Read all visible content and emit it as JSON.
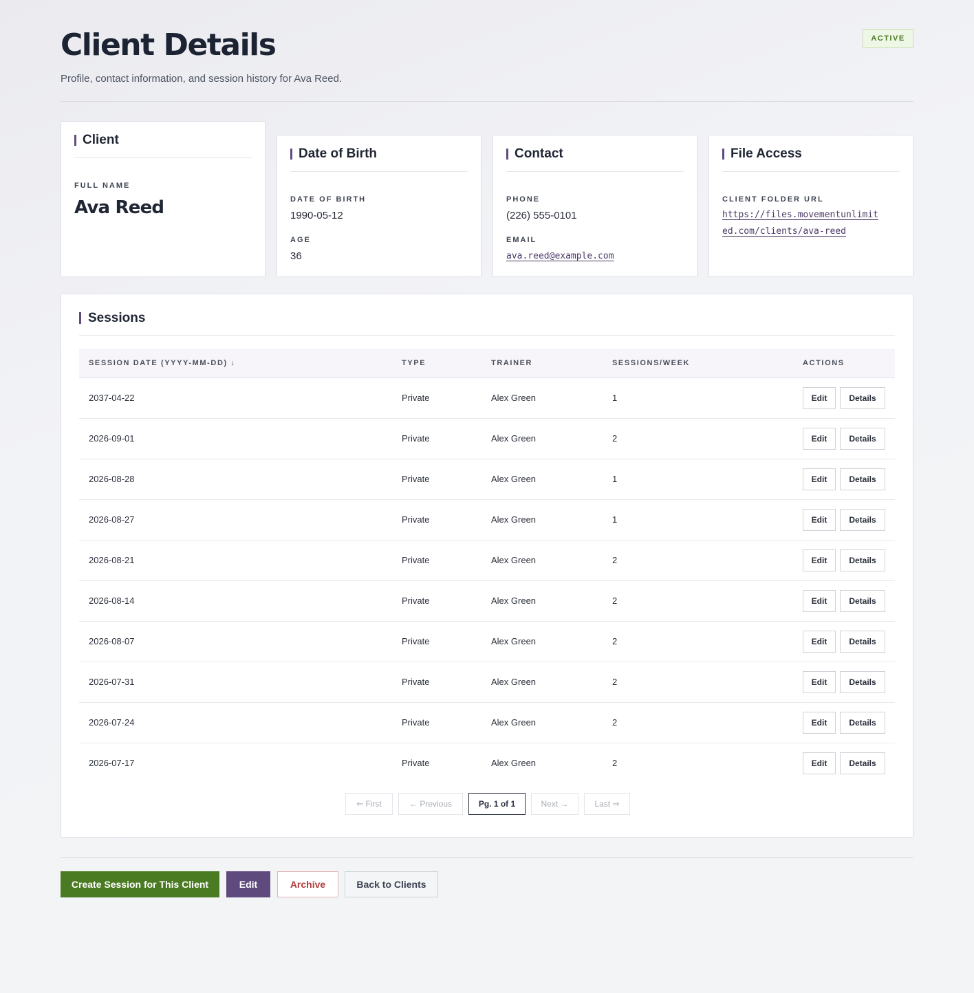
{
  "header": {
    "title": "Client Details",
    "subtitle": "Profile, contact information, and session history for Ava Reed.",
    "status": "ACTIVE"
  },
  "cards": {
    "client": {
      "title": "Client",
      "full_name_label": "FULL NAME",
      "full_name": "Ava Reed"
    },
    "dob": {
      "title": "Date of Birth",
      "dob_label": "DATE OF BIRTH",
      "dob": "1990-05-12",
      "age_label": "AGE",
      "age": "36"
    },
    "contact": {
      "title": "Contact",
      "phone_label": "PHONE",
      "phone": "(226) 555-0101",
      "email_label": "EMAIL",
      "email": "ava.reed@example.com"
    },
    "files": {
      "title": "File Access",
      "url_label": "CLIENT FOLDER URL",
      "url_line1": "https://files.movementunlimit",
      "url_line2": "ed.com/clients/ava-reed"
    }
  },
  "sessions": {
    "title": "Sessions",
    "columns": [
      "SESSION DATE (YYYY-MM-DD) ↓",
      "TYPE",
      "TRAINER",
      "SESSIONS/WEEK",
      "ACTIONS"
    ],
    "edit_label": "Edit",
    "details_label": "Details",
    "rows": [
      {
        "date": "2037-04-22",
        "type": "Private",
        "trainer": "Alex Green",
        "per_week": "1"
      },
      {
        "date": "2026-09-01",
        "type": "Private",
        "trainer": "Alex Green",
        "per_week": "2"
      },
      {
        "date": "2026-08-28",
        "type": "Private",
        "trainer": "Alex Green",
        "per_week": "1"
      },
      {
        "date": "2026-08-27",
        "type": "Private",
        "trainer": "Alex Green",
        "per_week": "1"
      },
      {
        "date": "2026-08-21",
        "type": "Private",
        "trainer": "Alex Green",
        "per_week": "2"
      },
      {
        "date": "2026-08-14",
        "type": "Private",
        "trainer": "Alex Green",
        "per_week": "2"
      },
      {
        "date": "2026-08-07",
        "type": "Private",
        "trainer": "Alex Green",
        "per_week": "2"
      },
      {
        "date": "2026-07-31",
        "type": "Private",
        "trainer": "Alex Green",
        "per_week": "2"
      },
      {
        "date": "2026-07-24",
        "type": "Private",
        "trainer": "Alex Green",
        "per_week": "2"
      },
      {
        "date": "2026-07-17",
        "type": "Private",
        "trainer": "Alex Green",
        "per_week": "2"
      }
    ],
    "pagination": {
      "first": "⇐ First",
      "previous": "← Previous",
      "current": "Pg. 1 of 1",
      "next": "Next →",
      "last": "Last ⇒"
    }
  },
  "actions": {
    "create": "Create Session for This Client",
    "edit": "Edit",
    "archive": "Archive",
    "back": "Back to Clients"
  },
  "colors": {
    "accent": "#5f4a7e",
    "primary_green": "#4a7a22",
    "archive_red": "#b23a3a"
  }
}
